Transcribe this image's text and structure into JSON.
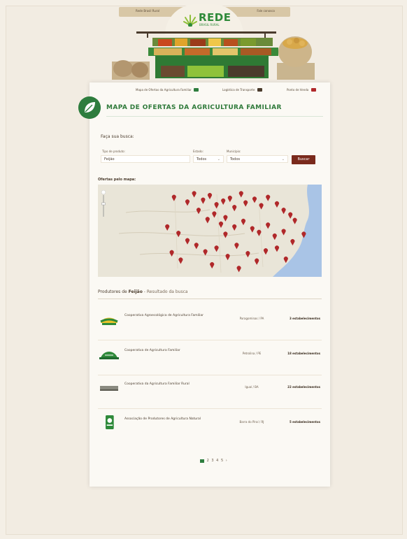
{
  "header": {
    "top_left_link": "Rede Brasil Rural",
    "top_right_link": "Fale conosco",
    "logo_text": "REDE",
    "logo_subtext": "BRASIL RURAL"
  },
  "utility_links": [
    {
      "label": "Mapa de Ofertas da Agricultura Familiar",
      "icon": "search-icon",
      "color": "#2e7d3e"
    },
    {
      "label": "Logística de Transporte",
      "icon": "truck-icon",
      "color": "#4a3b2c"
    },
    {
      "label": "Ponto de Venda",
      "icon": "flag-icon",
      "color": "#b0282a"
    }
  ],
  "page_title": "MAPA DE OFERTAS DA AGRICULTURA FAMILIAR",
  "search": {
    "heading": "Faça sua busca:",
    "product_label": "Tipo de produto:",
    "product_value": "Feijão",
    "state_label": "Estado:",
    "state_value": "Todos",
    "city_label": "Município:",
    "city_value": "Todos",
    "button_label": "Buscar"
  },
  "map": {
    "heading": "Ofertas pelo mapa:",
    "colors": {
      "water": "#a9c4e6",
      "land": "#e9e5d8",
      "marker": "#b0282a"
    },
    "markers": [
      [
        0.34,
        0.18
      ],
      [
        0.4,
        0.23
      ],
      [
        0.43,
        0.14
      ],
      [
        0.47,
        0.21
      ],
      [
        0.5,
        0.16
      ],
      [
        0.53,
        0.26
      ],
      [
        0.56,
        0.22
      ],
      [
        0.59,
        0.19
      ],
      [
        0.61,
        0.29
      ],
      [
        0.64,
        0.14
      ],
      [
        0.66,
        0.24
      ],
      [
        0.7,
        0.2
      ],
      [
        0.73,
        0.27
      ],
      [
        0.76,
        0.18
      ],
      [
        0.8,
        0.25
      ],
      [
        0.83,
        0.32
      ],
      [
        0.86,
        0.37
      ],
      [
        0.88,
        0.43
      ],
      [
        0.45,
        0.32
      ],
      [
        0.49,
        0.42
      ],
      [
        0.52,
        0.36
      ],
      [
        0.55,
        0.47
      ],
      [
        0.57,
        0.4
      ],
      [
        0.61,
        0.5
      ],
      [
        0.65,
        0.44
      ],
      [
        0.69,
        0.52
      ],
      [
        0.72,
        0.56
      ],
      [
        0.76,
        0.48
      ],
      [
        0.79,
        0.6
      ],
      [
        0.83,
        0.55
      ],
      [
        0.31,
        0.5
      ],
      [
        0.36,
        0.57
      ],
      [
        0.4,
        0.65
      ],
      [
        0.44,
        0.7
      ],
      [
        0.48,
        0.77
      ],
      [
        0.53,
        0.73
      ],
      [
        0.58,
        0.82
      ],
      [
        0.62,
        0.7
      ],
      [
        0.67,
        0.79
      ],
      [
        0.71,
        0.87
      ],
      [
        0.75,
        0.76
      ],
      [
        0.8,
        0.73
      ],
      [
        0.84,
        0.85
      ],
      [
        0.33,
        0.78
      ],
      [
        0.37,
        0.86
      ],
      [
        0.51,
        0.91
      ],
      [
        0.63,
        0.95
      ],
      [
        0.87,
        0.66
      ],
      [
        0.92,
        0.58
      ],
      [
        0.57,
        0.58
      ]
    ]
  },
  "results": {
    "product": "Feijão",
    "heading_prefix": "Produtores de",
    "heading_suffix": "- Resultado da busca",
    "rows": [
      {
        "name": "Cooperativa Agroecológica de Agricultura Familiar",
        "city": "Paragominas / PA",
        "count": "3 estabelecimentos",
        "logo": "sunrise-logo"
      },
      {
        "name": "Cooperativa de Agricultura Familiar",
        "city": "Petrolina / PE",
        "count": "18 estabelecimentos",
        "logo": "hill-logo"
      },
      {
        "name": "Cooperativa da Agricultura Familiar Rural",
        "city": "Iguaí / BA",
        "count": "22 estabelecimentos",
        "logo": "bar-logo"
      },
      {
        "name": "Associação de Produtores de Agricultura Natural",
        "city": "Barra do Piraí / RJ",
        "count": "5 estabelecimentos",
        "logo": "badge-logo"
      }
    ]
  },
  "pagination": {
    "pages": [
      "1",
      "2",
      "3",
      "4",
      "5"
    ],
    "next": "›",
    "current": 1
  }
}
